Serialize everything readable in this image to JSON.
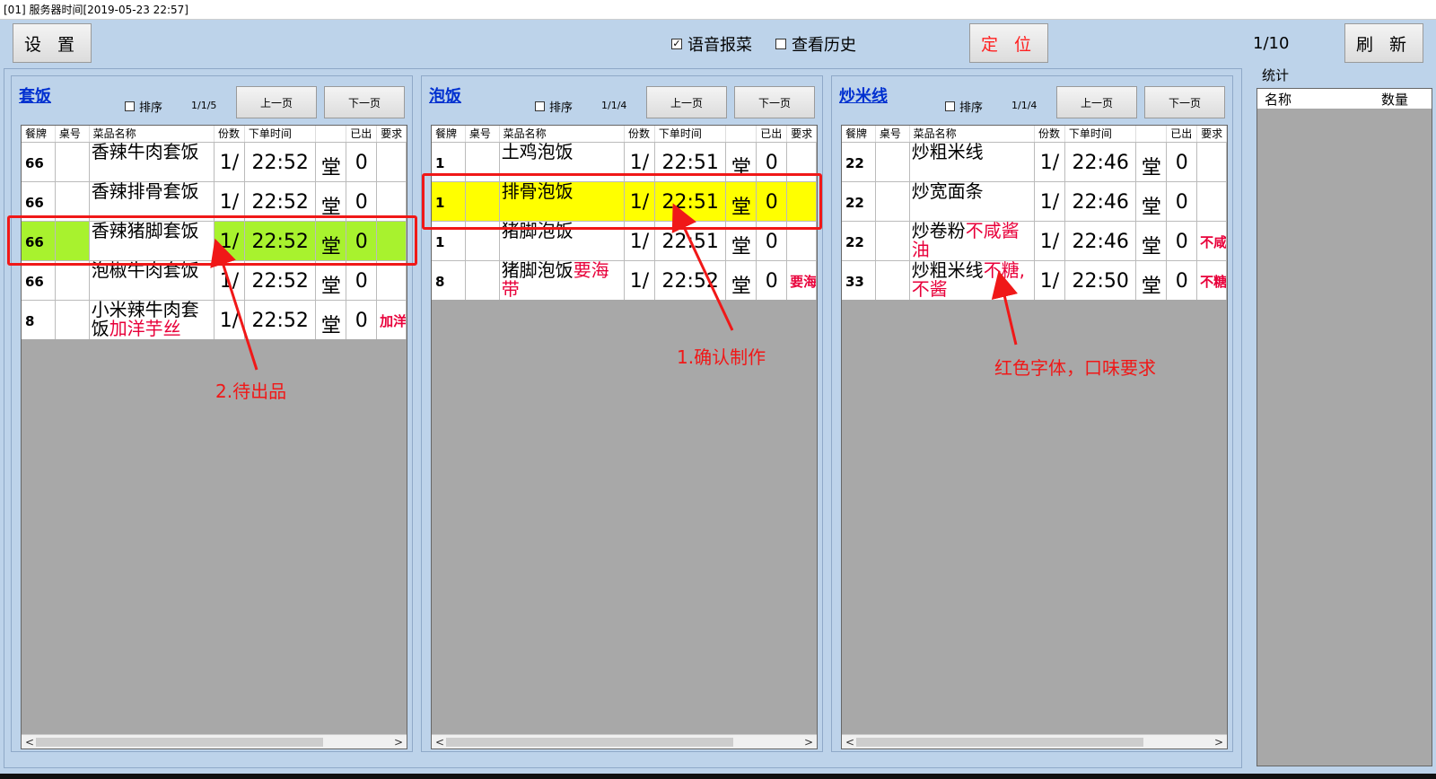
{
  "title_bar": "[01]  服务器时间[2019-05-23 22:57]",
  "toolbar": {
    "settings": "设 置",
    "voice_label": "语音报菜",
    "voice_checked": true,
    "history_label": "查看历史",
    "history_checked": false,
    "locate": "定 位",
    "page": "1/10",
    "refresh": "刷 新"
  },
  "columns": [
    "餐牌",
    "桌号",
    "菜品名称",
    "份数",
    "下单时间",
    "",
    "已出",
    "要求"
  ],
  "sort_label": "排序",
  "prev_label": "上一页",
  "next_label": "下一页",
  "panels": [
    {
      "category": "套饭",
      "page": "1/1/5",
      "rows": [
        {
          "plate": "66",
          "table": "",
          "name": "香辣牛肉套饭",
          "name_note": "",
          "qty": "1/",
          "time": "22:52",
          "type": "堂",
          "done": "0",
          "req": "",
          "state": "normal"
        },
        {
          "plate": "66",
          "table": "",
          "name": "香辣排骨套饭",
          "name_note": "",
          "qty": "1/",
          "time": "22:52",
          "type": "堂",
          "done": "0",
          "req": "",
          "state": "normal"
        },
        {
          "plate": "66",
          "table": "",
          "name": "香辣猪脚套饭",
          "name_note": "",
          "qty": "1/",
          "time": "22:52",
          "type": "堂",
          "done": "0",
          "req": "",
          "state": "ready"
        },
        {
          "plate": "66",
          "table": "",
          "name": "泡椒牛肉套饭",
          "name_note": "",
          "qty": "1/",
          "time": "22:52",
          "type": "堂",
          "done": "0",
          "req": "",
          "state": "normal"
        },
        {
          "plate": "8",
          "table": "",
          "name": "小米辣牛肉套饭",
          "name_note": "加洋芋丝",
          "qty": "1/",
          "time": "22:52",
          "type": "堂",
          "done": "0",
          "req": "加洋",
          "state": "normal"
        }
      ]
    },
    {
      "category": "泡饭",
      "page": "1/1/4",
      "rows": [
        {
          "plate": "1",
          "table": "",
          "name": "土鸡泡饭",
          "name_note": "",
          "qty": "1/",
          "time": "22:51",
          "type": "堂",
          "done": "0",
          "req": "",
          "state": "normal"
        },
        {
          "plate": "1",
          "table": "",
          "name": "排骨泡饭",
          "name_note": "",
          "qty": "1/",
          "time": "22:51",
          "type": "堂",
          "done": "0",
          "req": "",
          "state": "confirmed"
        },
        {
          "plate": "1",
          "table": "",
          "name": "猪脚泡饭",
          "name_note": "",
          "qty": "1/",
          "time": "22:51",
          "type": "堂",
          "done": "0",
          "req": "",
          "state": "normal"
        },
        {
          "plate": "8",
          "table": "",
          "name": "猪脚泡饭",
          "name_note": "要海带",
          "qty": "1/",
          "time": "22:52",
          "type": "堂",
          "done": "0",
          "req": "要海",
          "state": "normal"
        }
      ]
    },
    {
      "category": "炒米线",
      "page": "1/1/4",
      "rows": [
        {
          "plate": "22",
          "table": "",
          "name": "炒粗米线",
          "name_note": "",
          "qty": "1/",
          "time": "22:46",
          "type": "堂",
          "done": "0",
          "req": "",
          "state": "normal"
        },
        {
          "plate": "22",
          "table": "",
          "name": "炒宽面条",
          "name_note": "",
          "qty": "1/",
          "time": "22:46",
          "type": "堂",
          "done": "0",
          "req": "",
          "state": "normal"
        },
        {
          "plate": "22",
          "table": "",
          "name": "炒卷粉",
          "name_note": "不咸酱油",
          "qty": "1/",
          "time": "22:46",
          "type": "堂",
          "done": "0",
          "req": "不咸",
          "state": "normal"
        },
        {
          "plate": "33",
          "table": "",
          "name": "炒粗米线",
          "name_note": "不糖,不酱",
          "qty": "1/",
          "time": "22:50",
          "type": "堂",
          "done": "0",
          "req": "不糖",
          "state": "normal"
        }
      ]
    }
  ],
  "stats": {
    "title": "统计",
    "col_name": "名称",
    "col_qty": "数量"
  },
  "annotations": {
    "confirm": "1.确认制作",
    "ready": "2.待出品",
    "red_font": "红色字体，口味要求"
  },
  "colors": {
    "background": "#bdd3ea",
    "ready_row": "#a8f22e",
    "confirmed_row": "#ffff00",
    "note_text": "#e8003a",
    "annotation": "#f01818",
    "category_link": "#0030d0"
  }
}
